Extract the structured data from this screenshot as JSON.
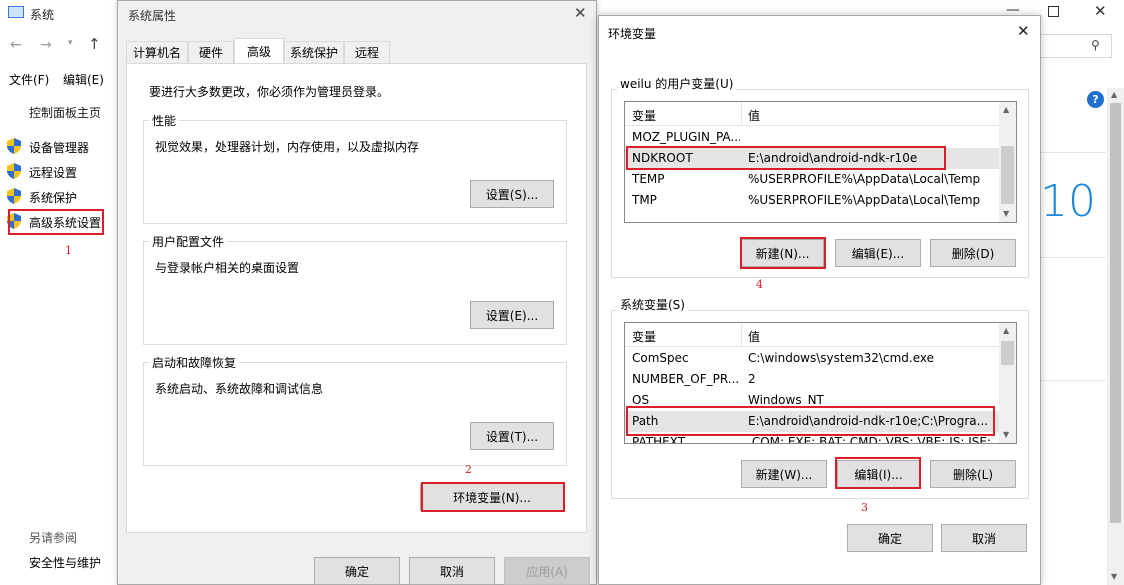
{
  "control_panel": {
    "title": "系统",
    "menu": [
      "文件(F)",
      "编辑(E)"
    ],
    "home_link": "控制面板主页",
    "links": [
      "设备管理器",
      "远程设置",
      "系统保护",
      "高级系统设置"
    ],
    "see_also": "另请参阅",
    "security_link": "安全性与维护",
    "win10_fragment": "10",
    "help_glyph": "?"
  },
  "sysprops": {
    "title": "系统属性",
    "tabs": [
      "计算机名",
      "硬件",
      "高级",
      "系统保护",
      "远程"
    ],
    "admin_note": "要进行大多数更改，你必须作为管理员登录。",
    "performance": {
      "title": "性能",
      "desc": "视觉效果，处理器计划，内存使用，以及虚拟内存",
      "button": "设置(S)..."
    },
    "user_profile": {
      "title": "用户配置文件",
      "desc": "与登录帐户相关的桌面设置",
      "button": "设置(E)..."
    },
    "startup": {
      "title": "启动和故障恢复",
      "desc": "系统启动、系统故障和调试信息",
      "button": "设置(T)..."
    },
    "env_button": "环境变量(N)...",
    "ok": "确定",
    "cancel": "取消",
    "apply": "应用(A)"
  },
  "envvars": {
    "title": "环境变量",
    "user_group": "weilu 的用户变量(U)",
    "col_var": "变量",
    "col_val": "值",
    "user_vars": [
      {
        "name": "MOZ_PLUGIN_PA...",
        "value": ""
      },
      {
        "name": "NDKROOT",
        "value": "E:\\android\\android-ndk-r10e"
      },
      {
        "name": "TEMP",
        "value": "%USERPROFILE%\\AppData\\Local\\Temp"
      },
      {
        "name": "TMP",
        "value": "%USERPROFILE%\\AppData\\Local\\Temp"
      }
    ],
    "user_buttons": {
      "new": "新建(N)...",
      "edit": "编辑(E)...",
      "delete": "删除(D)"
    },
    "sys_group": "系统变量(S)",
    "sys_vars": [
      {
        "name": "ComSpec",
        "value": "C:\\windows\\system32\\cmd.exe"
      },
      {
        "name": "NUMBER_OF_PR...",
        "value": "2"
      },
      {
        "name": "OS",
        "value": "Windows_NT"
      },
      {
        "name": "Path",
        "value": "E:\\android\\android-ndk-r10e;C:\\Progra..."
      },
      {
        "name": "PATHEXT",
        "value": ".COM;.EXE;.BAT;.CMD;.VBS;.VBE;.JS;.JSE;..."
      }
    ],
    "sys_buttons": {
      "new": "新建(W)...",
      "edit": "编辑(I)...",
      "delete": "删除(L)"
    },
    "ok": "确定",
    "cancel": "取消"
  },
  "annotations": [
    "1",
    "2",
    "3",
    "4"
  ],
  "colors": {
    "annotation": "#d9202a",
    "accent": "#0078d7"
  }
}
